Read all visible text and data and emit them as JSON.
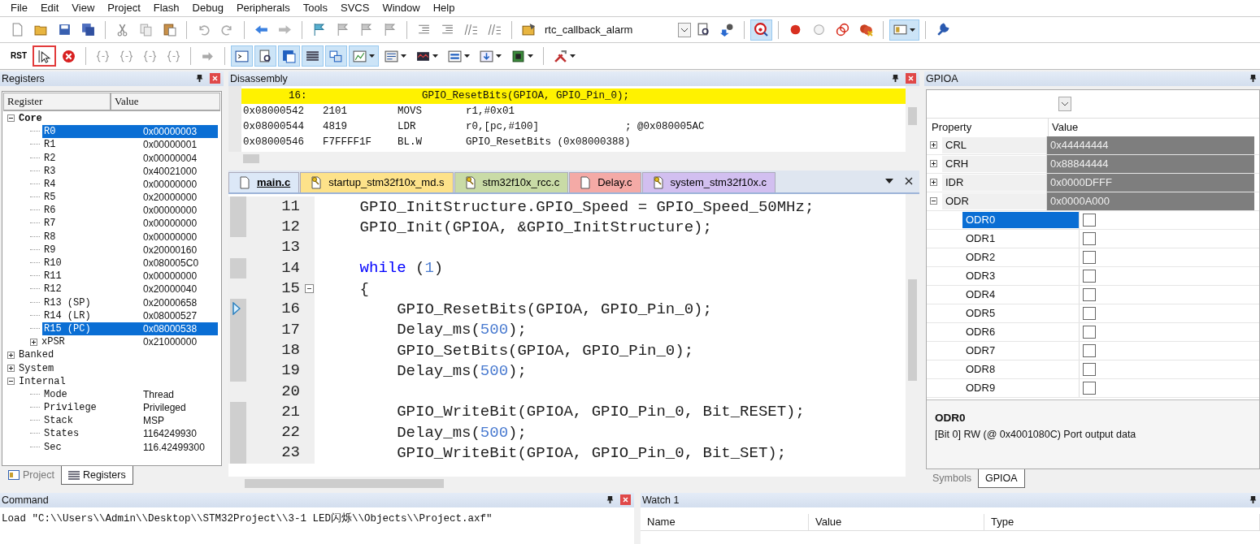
{
  "menu": [
    "File",
    "Edit",
    "View",
    "Project",
    "Flash",
    "Debug",
    "Peripherals",
    "Tools",
    "SVCS",
    "Window",
    "Help"
  ],
  "toolbar": [
    {
      "kind": "newfile",
      "pressed": false,
      "dropdown": false
    },
    {
      "kind": "open",
      "pressed": false,
      "dropdown": false
    },
    {
      "kind": "save",
      "pressed": false,
      "dropdown": false
    },
    {
      "kind": "saveall",
      "pressed": false,
      "dropdown": false
    },
    {
      "kind": "separator"
    },
    {
      "kind": "cut",
      "pressed": false,
      "dropdown": false
    },
    {
      "kind": "copy",
      "pressed": false,
      "dropdown": false
    },
    {
      "kind": "paste",
      "pressed": false,
      "dropdown": false
    },
    {
      "kind": "separator"
    },
    {
      "kind": "undo",
      "pressed": false,
      "dropdown": false
    },
    {
      "kind": "redo",
      "pressed": false,
      "dropdown": false
    },
    {
      "kind": "separator"
    },
    {
      "kind": "back",
      "pressed": false,
      "dropdown": false
    },
    {
      "kind": "forward",
      "pressed": false,
      "dropdown": false
    },
    {
      "kind": "separator"
    },
    {
      "kind": "bookmark",
      "pressed": false,
      "dropdown": false
    },
    {
      "kind": "bookmarkgrey",
      "pressed": false,
      "dropdown": false
    },
    {
      "kind": "bookmarkgrey",
      "pressed": false,
      "dropdown": false
    },
    {
      "kind": "bookmarkgrey",
      "pressed": false,
      "dropdown": false
    },
    {
      "kind": "separator"
    },
    {
      "kind": "indent",
      "pressed": false,
      "dropdown": false
    },
    {
      "kind": "indent",
      "pressed": false,
      "dropdown": false
    },
    {
      "kind": "comment",
      "pressed": false,
      "dropdown": false
    },
    {
      "kind": "comment",
      "pressed": false,
      "dropdown": false
    },
    {
      "kind": "separator"
    },
    {
      "kind": "projectfile",
      "pressed": false,
      "dropdown": false
    },
    {
      "kind": "combo",
      "value": "rtc_callback_alarm"
    },
    {
      "kind": "find",
      "pressed": false,
      "dropdown": false
    },
    {
      "kind": "config",
      "pressed": false,
      "dropdown": false
    },
    {
      "kind": "separator"
    },
    {
      "kind": "debug",
      "pressed": true,
      "dropdown": false
    },
    {
      "kind": "separator"
    },
    {
      "kind": "breakpoint",
      "pressed": false,
      "dropdown": false
    },
    {
      "kind": "ring",
      "pressed": false,
      "dropdown": false
    },
    {
      "kind": "rings",
      "pressed": false,
      "dropdown": false
    },
    {
      "kind": "killbreakpoints",
      "pressed": false,
      "dropdown": false
    },
    {
      "kind": "separator"
    },
    {
      "kind": "window",
      "pressed": true,
      "dropdown": true
    },
    {
      "kind": "separator"
    },
    {
      "kind": "wrench",
      "pressed": false,
      "dropdown": false
    }
  ],
  "debug_toolbar": [
    {
      "kind": "reset",
      "label": "RST",
      "pressed": false,
      "highlighted": false
    },
    {
      "kind": "cursor",
      "pressed": false,
      "dropdown": false,
      "highlighted": true
    },
    {
      "kind": "stop",
      "pressed": false,
      "dropdown": false,
      "highlighted": false
    },
    {
      "kind": "separator"
    },
    {
      "kind": "braces",
      "pressed": false,
      "dropdown": false,
      "highlighted": false
    },
    {
      "kind": "braces",
      "pressed": false,
      "dropdown": false,
      "highlighted": false
    },
    {
      "kind": "braces",
      "pressed": false,
      "dropdown": false,
      "highlighted": false
    },
    {
      "kind": "braces",
      "pressed": false,
      "dropdown": false,
      "highlighted": false
    },
    {
      "kind": "separator"
    },
    {
      "kind": "arrow",
      "pressed": false,
      "dropdown": false,
      "highlighted": false
    },
    {
      "kind": "separator"
    },
    {
      "kind": "console",
      "pressed": true,
      "dropdown": false,
      "highlighted": false
    },
    {
      "kind": "find",
      "pressed": true,
      "dropdown": false,
      "highlighted": false
    },
    {
      "kind": "symbols",
      "pressed": true,
      "dropdown": false,
      "highlighted": false
    },
    {
      "kind": "list",
      "pressed": true,
      "dropdown": false,
      "highlighted": false
    },
    {
      "kind": "stack",
      "pressed": true,
      "dropdown": false,
      "highlighted": false
    },
    {
      "kind": "watch",
      "pressed": true,
      "dropdown": true,
      "highlighted": false
    },
    {
      "kind": "memory",
      "pressed": false,
      "dropdown": true,
      "highlighted": false
    },
    {
      "kind": "serial",
      "pressed": false,
      "dropdown": true,
      "highlighted": false
    },
    {
      "kind": "analyzer",
      "pressed": false,
      "dropdown": true,
      "highlighted": false
    },
    {
      "kind": "trace",
      "pressed": false,
      "dropdown": true,
      "highlighted": false
    },
    {
      "kind": "chip",
      "pressed": false,
      "dropdown": true,
      "highlighted": false
    },
    {
      "kind": "separator"
    },
    {
      "kind": "tools",
      "pressed": false,
      "dropdown": true,
      "highlighted": false
    }
  ],
  "registers_panel": {
    "title": "Registers",
    "columns": [
      "Register",
      "Value"
    ],
    "tree": [
      {
        "name": "Core",
        "expanded": true,
        "selected": false,
        "children": [
          {
            "name": "R0",
            "value": "0x00000003",
            "selected": true
          },
          {
            "name": "R1",
            "value": "0x00000001",
            "selected": false
          },
          {
            "name": "R2",
            "value": "0x00000004",
            "selected": false
          },
          {
            "name": "R3",
            "value": "0x40021000",
            "selected": false
          },
          {
            "name": "R4",
            "value": "0x00000000",
            "selected": false
          },
          {
            "name": "R5",
            "value": "0x20000000",
            "selected": false
          },
          {
            "name": "R6",
            "value": "0x00000000",
            "selected": false
          },
          {
            "name": "R7",
            "value": "0x00000000",
            "selected": false
          },
          {
            "name": "R8",
            "value": "0x00000000",
            "selected": false
          },
          {
            "name": "R9",
            "value": "0x20000160",
            "selected": false
          },
          {
            "name": "R10",
            "value": "0x080005C0",
            "selected": false
          },
          {
            "name": "R11",
            "value": "0x00000000",
            "selected": false
          },
          {
            "name": "R12",
            "value": "0x20000040",
            "selected": false
          },
          {
            "name": "R13 (SP)",
            "value": "0x20000658",
            "selected": false
          },
          {
            "name": "R14 (LR)",
            "value": "0x08000527",
            "selected": false
          },
          {
            "name": "R15 (PC)",
            "value": "0x08000538",
            "selected": true
          },
          {
            "name": "xPSR",
            "value": "0x21000000",
            "expanded": false,
            "selected": false
          }
        ]
      },
      {
        "name": "Banked",
        "expanded": false,
        "selected": false
      },
      {
        "name": "System",
        "expanded": false,
        "selected": false
      },
      {
        "name": "Internal",
        "expanded": true,
        "selected": false,
        "children": [
          {
            "name": "Mode",
            "value": "Thread",
            "selected": false
          },
          {
            "name": "Privilege",
            "value": "Privileged",
            "selected": false
          },
          {
            "name": "Stack",
            "value": "MSP",
            "selected": false
          },
          {
            "name": "States",
            "value": "1164249930",
            "selected": false
          },
          {
            "name": "Sec",
            "value": "116.42499300",
            "selected": false
          }
        ]
      }
    ],
    "tabs": [
      {
        "label": "Project",
        "kind": "project",
        "selected": false
      },
      {
        "label": "Registers",
        "kind": "registers",
        "selected": true
      }
    ]
  },
  "disassembly": {
    "title": "Disassembly",
    "lines": [
      {
        "kind": "source",
        "line": "16:",
        "text": "GPIO_ResetBits(GPIOA, GPIO_Pin_0);",
        "current": true
      },
      {
        "kind": "instruction",
        "address": "0x08000542",
        "opcode": "2101",
        "mnemonic": "MOVS",
        "operands": "r1,#0x01",
        "current": false
      },
      {
        "kind": "instruction",
        "address": "0x08000544",
        "opcode": "4819",
        "mnemonic": "LDR",
        "operands": "r0,[pc,#100]",
        "comment": "; @0x080005AC",
        "current": false
      },
      {
        "kind": "instruction",
        "address": "0x08000546",
        "opcode": "F7FFFF1F",
        "mnemonic": "BL.W",
        "operands": "GPIO_ResetBits (0x08000388)",
        "current": false
      }
    ]
  },
  "editor": {
    "tabs": [
      {
        "label": "main.c",
        "color": "#dce8f7",
        "read_only": false,
        "selected": true
      },
      {
        "label": "startup_stm32f10x_md.s",
        "color": "#fde28a",
        "read_only": true,
        "selected": false
      },
      {
        "label": "stm32f10x_rcc.c",
        "color": "#c9dba6",
        "read_only": true,
        "selected": false
      },
      {
        "label": "Delay.c",
        "color": "#f4aaa6",
        "read_only": false,
        "selected": false
      },
      {
        "label": "system_stm32f10x.c",
        "color": "#d2bff0",
        "read_only": true,
        "selected": false
      }
    ],
    "lines": [
      {
        "number": "11",
        "executable": true,
        "current": false,
        "fold": false,
        "tokens": [
          {
            "text": "    GPIO_InitStructure.GPIO_Speed = GPIO_Speed_50MHz;",
            "kind": "plain"
          }
        ]
      },
      {
        "number": "12",
        "executable": true,
        "current": false,
        "fold": false,
        "tokens": [
          {
            "text": "    GPIO_Init(GPIOA, &GPIO_InitStructure);",
            "kind": "plain"
          }
        ]
      },
      {
        "number": "13",
        "executable": false,
        "current": false,
        "fold": false
      },
      {
        "number": "14",
        "executable": true,
        "current": false,
        "fold": false,
        "tokens": [
          {
            "text": "    while",
            "kind": "keyword"
          },
          {
            "text": " (",
            "kind": "plain"
          },
          {
            "text": "1",
            "kind": "number"
          },
          {
            "text": ")",
            "kind": "plain"
          }
        ]
      },
      {
        "number": "15",
        "executable": false,
        "current": false,
        "fold": true,
        "tokens": [
          {
            "text": "    {",
            "kind": "plain"
          }
        ]
      },
      {
        "number": "16",
        "executable": true,
        "current": true,
        "fold": false,
        "tokens": [
          {
            "text": "        GPIO_ResetBits(GPIOA, GPIO_Pin_0);",
            "kind": "plain"
          }
        ]
      },
      {
        "number": "17",
        "executable": true,
        "current": false,
        "fold": false,
        "tokens": [
          {
            "text": "        Delay_ms(",
            "kind": "plain"
          },
          {
            "text": "500",
            "kind": "number"
          },
          {
            "text": ");",
            "kind": "plain"
          }
        ]
      },
      {
        "number": "18",
        "executable": true,
        "current": false,
        "fold": false,
        "tokens": [
          {
            "text": "        GPIO_SetBits(GPIOA, GPIO_Pin_0);",
            "kind": "plain"
          }
        ]
      },
      {
        "number": "19",
        "executable": true,
        "current": false,
        "fold": false,
        "tokens": [
          {
            "text": "        Delay_ms(",
            "kind": "plain"
          },
          {
            "text": "500",
            "kind": "number"
          },
          {
            "text": ");",
            "kind": "plain"
          }
        ]
      },
      {
        "number": "20",
        "executable": false,
        "current": false,
        "fold": false
      },
      {
        "number": "21",
        "executable": true,
        "current": false,
        "fold": false,
        "tokens": [
          {
            "text": "        GPIO_WriteBit(GPIOA, GPIO_Pin_0, Bit_RESET);",
            "kind": "plain"
          }
        ]
      },
      {
        "number": "22",
        "executable": true,
        "current": false,
        "fold": false,
        "tokens": [
          {
            "text": "        Delay_ms(",
            "kind": "plain"
          },
          {
            "text": "500",
            "kind": "number"
          },
          {
            "text": ");",
            "kind": "plain"
          }
        ]
      },
      {
        "number": "23",
        "executable": true,
        "current": false,
        "fold": false,
        "tokens": [
          {
            "text": "        GPIO_WriteBit(GPIOA, GPIO_Pin_0, Bit_SET);",
            "kind": "plain"
          }
        ]
      }
    ]
  },
  "peripheral_panel": {
    "title": "GPIOA",
    "columns": [
      "Property",
      "Value"
    ],
    "properties": [
      {
        "name": "CRL",
        "value": "0x44444444",
        "expanded": false,
        "selected": false
      },
      {
        "name": "CRH",
        "value": "0x88844444",
        "expanded": false,
        "selected": false
      },
      {
        "name": "IDR",
        "value": "0x0000DFFF",
        "expanded": false,
        "selected": false
      },
      {
        "name": "ODR",
        "value": "0x0000A000",
        "expanded": true,
        "selected": false,
        "children": [
          {
            "name": "ODR0",
            "checked": false,
            "selected": true
          },
          {
            "name": "ODR1",
            "checked": false,
            "selected": false
          },
          {
            "name": "ODR2",
            "checked": false,
            "selected": false
          },
          {
            "name": "ODR3",
            "checked": false,
            "selected": false
          },
          {
            "name": "ODR4",
            "checked": false,
            "selected": false
          },
          {
            "name": "ODR5",
            "checked": false,
            "selected": false
          },
          {
            "name": "ODR6",
            "checked": false,
            "selected": false
          },
          {
            "name": "ODR7",
            "checked": false,
            "selected": false
          },
          {
            "name": "ODR8",
            "checked": false,
            "selected": false
          },
          {
            "name": "ODR9",
            "checked": false,
            "selected": false
          }
        ]
      }
    ],
    "description": {
      "title": "ODR0",
      "text": "[Bit 0] RW (@ 0x4001080C) Port output data"
    },
    "tabs": [
      {
        "label": "Symbols",
        "selected": false
      },
      {
        "label": "GPIOA",
        "selected": true
      }
    ]
  },
  "command_panel": {
    "title": "Command",
    "output": "Load \"C:\\\\Users\\\\Admin\\\\Desktop\\\\STM32Project\\\\3-1 LED闪烁\\\\Objects\\\\Project.axf\""
  },
  "watch_panel": {
    "title": "Watch 1",
    "columns": [
      "Name",
      "Value",
      "Type"
    ]
  }
}
